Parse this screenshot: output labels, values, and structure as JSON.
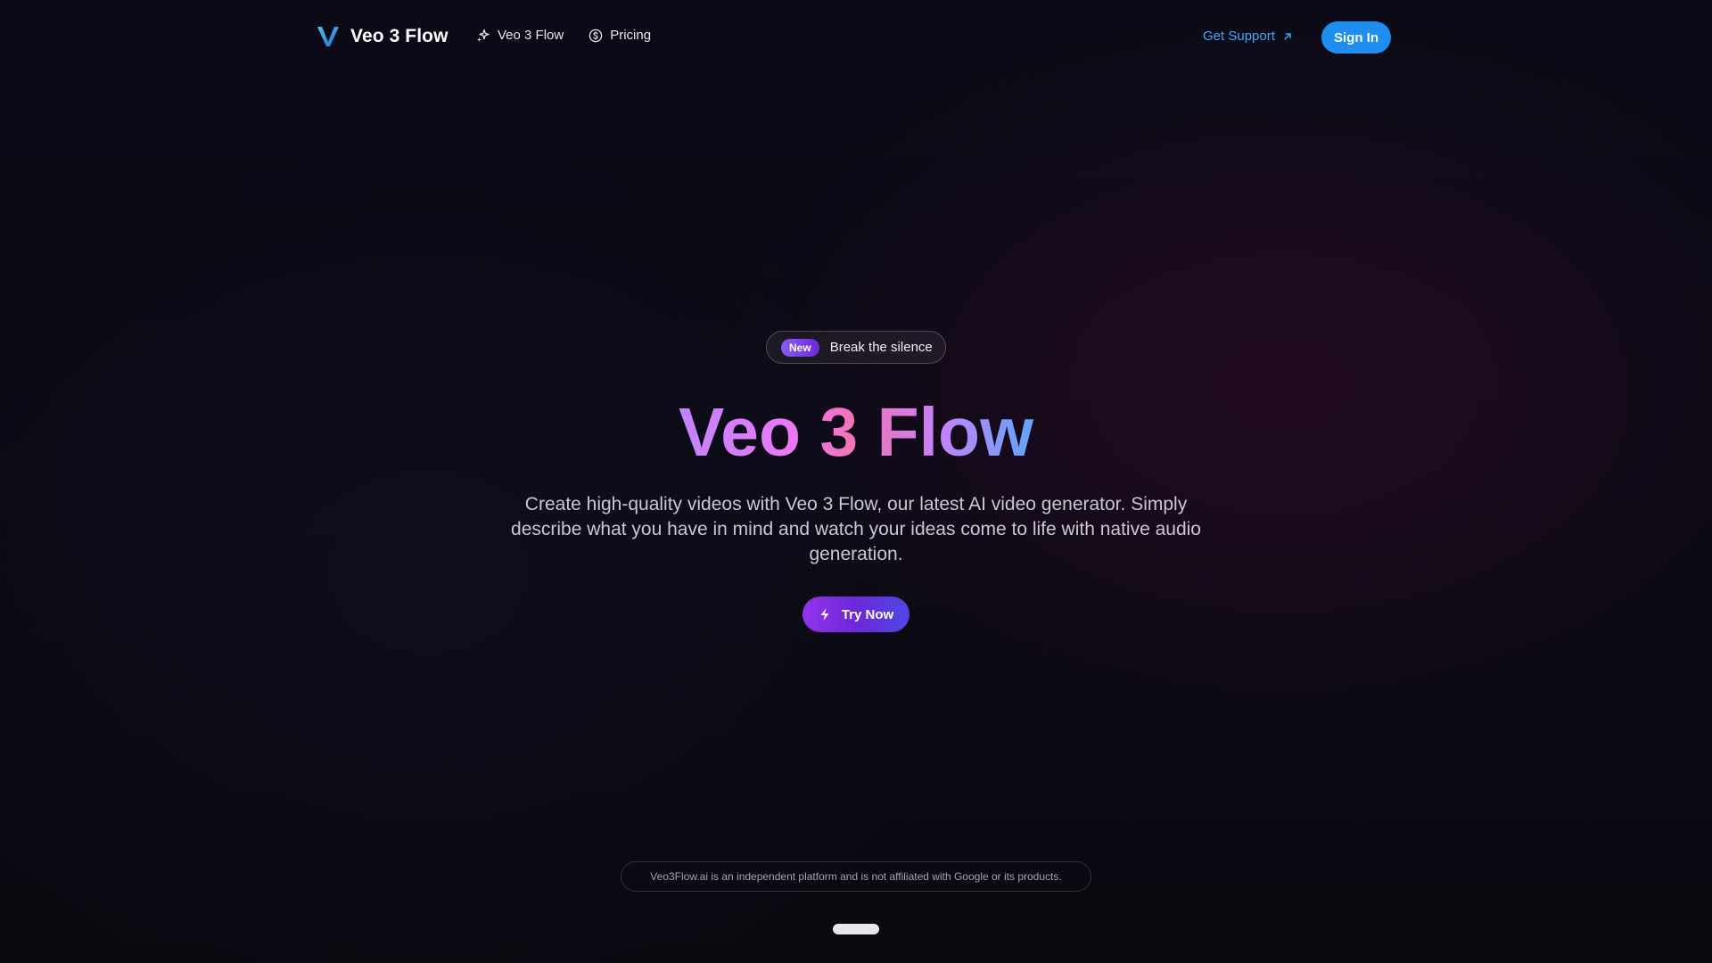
{
  "header": {
    "brand": "Veo 3 Flow",
    "logo_icon": "v-logo-icon",
    "nav": [
      {
        "label": "Veo 3 Flow",
        "icon": "sparkles-icon"
      },
      {
        "label": "Pricing",
        "icon": "dollar-circle-icon"
      }
    ],
    "support_label": "Get Support",
    "support_icon": "arrow-up-right-icon",
    "signin_label": "Sign In"
  },
  "hero": {
    "badge_label": "New",
    "badge_text": "Break the silence",
    "title": "Veo 3 Flow",
    "description": "Create high-quality videos with Veo 3 Flow, our latest AI video generator. Simply describe what you have in mind and watch your ideas come to life with native audio generation.",
    "cta_label": "Try Now",
    "cta_icon": "lightning-icon"
  },
  "footer": {
    "disclaimer": "Veo3Flow.ai is an independent platform and is not affiliated with Google or its products."
  },
  "colors": {
    "background": "#0a0b16",
    "accent_blue": "#1f8ef1",
    "link_blue": "#3ea7ff",
    "purple": "#8b5cf6",
    "pink": "#f472b6"
  }
}
